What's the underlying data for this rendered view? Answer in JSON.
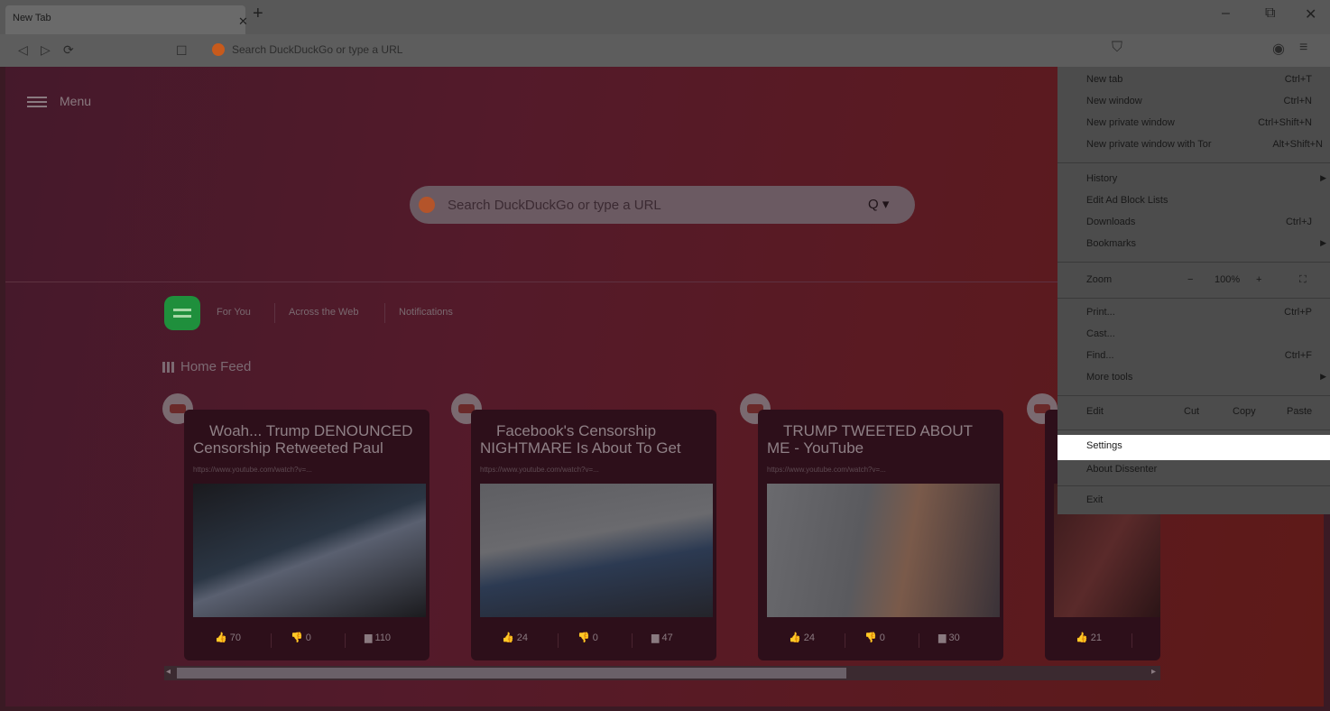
{
  "tab": {
    "title": "New Tab"
  },
  "address": {
    "placeholder": "Search DuckDuckGo or type a URL"
  },
  "page": {
    "menu_label": "Menu",
    "search_placeholder": "Search DuckDuckGo or type a URL",
    "feed_tabs": [
      "For You",
      "Across the Web",
      "Notifications"
    ],
    "home_feed": "Home Feed",
    "cards": [
      {
        "title": "Woah... Trump DENOUNCED Censorship Retweeted Paul",
        "url": "https://www.youtube.com/watch?v=...",
        "likes": "70",
        "dislikes": "0",
        "comments": "110"
      },
      {
        "title": "Facebook's Censorship NIGHTMARE Is About To Get",
        "url": "https://www.youtube.com/watch?v=...",
        "likes": "24",
        "dislikes": "0",
        "comments": "47"
      },
      {
        "title": "TRUMP TWEETED ABOUT ME - YouTube",
        "url": "https://www.youtube.com/watch?v=...",
        "likes": "24",
        "dislikes": "0",
        "comments": "30"
      },
      {
        "title": "",
        "url": "",
        "likes": "21",
        "dislikes": "",
        "comments": ""
      }
    ]
  },
  "menu": {
    "items": [
      {
        "label": "New tab",
        "shortcut": "Ctrl+T"
      },
      {
        "label": "New window",
        "shortcut": "Ctrl+N"
      },
      {
        "label": "New private window",
        "shortcut": "Ctrl+Shift+N"
      },
      {
        "label": "New private window with Tor",
        "shortcut": "Alt+Shift+N"
      },
      {
        "label": "History",
        "shortcut": ""
      },
      {
        "label": "Edit Ad Block Lists",
        "shortcut": ""
      },
      {
        "label": "Downloads",
        "shortcut": "Ctrl+J"
      },
      {
        "label": "Bookmarks",
        "shortcut": ""
      },
      {
        "label": "Print...",
        "shortcut": "Ctrl+P"
      },
      {
        "label": "Cast...",
        "shortcut": ""
      },
      {
        "label": "Find...",
        "shortcut": "Ctrl+F"
      },
      {
        "label": "More tools",
        "shortcut": ""
      },
      {
        "label": "Settings",
        "shortcut": ""
      },
      {
        "label": "About Dissenter",
        "shortcut": ""
      },
      {
        "label": "Exit",
        "shortcut": ""
      }
    ],
    "zoom_label": "Zoom",
    "zoom_minus": "−",
    "zoom_value": "100%",
    "zoom_plus": "+",
    "edit_label": "Edit",
    "edit_cut": "Cut",
    "edit_copy": "Copy",
    "edit_paste": "Paste"
  }
}
